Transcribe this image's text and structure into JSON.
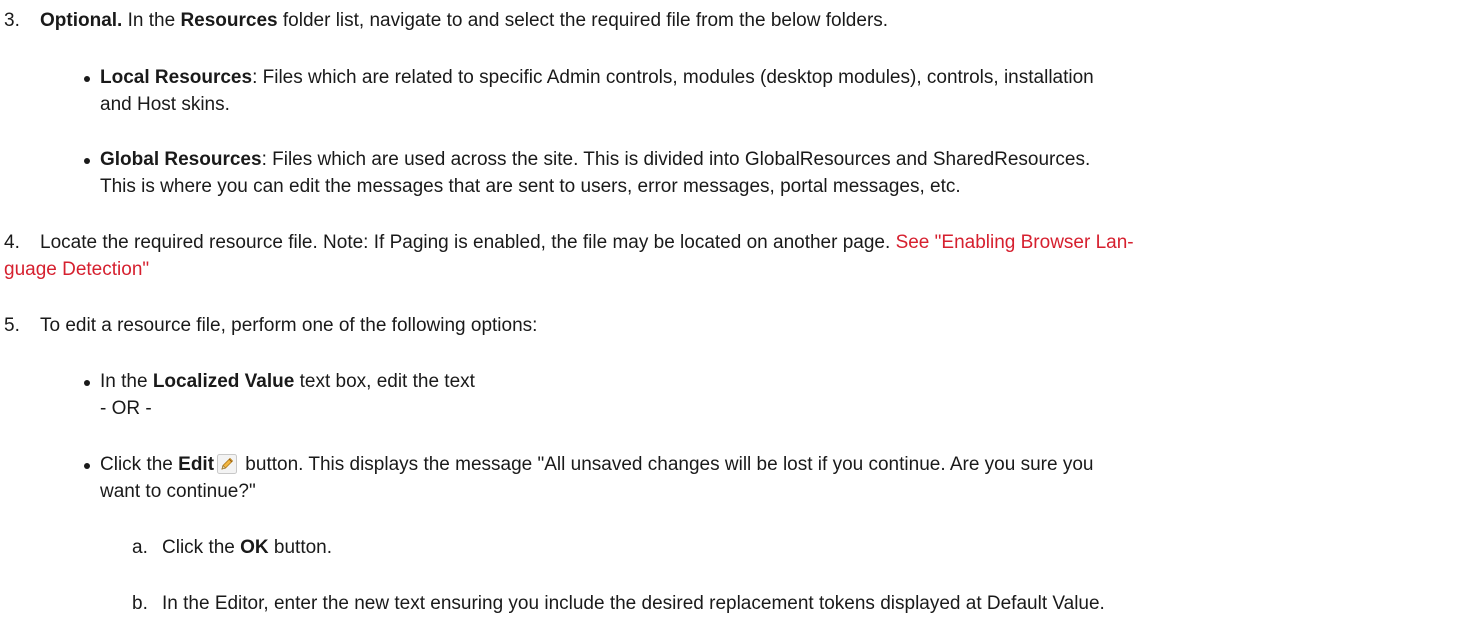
{
  "step3": {
    "number": "3.",
    "lead_bold": "Optional.",
    "text_a": " In the ",
    "resources_bold": "Resources",
    "text_b": " folder list, navigate to and select the required file from the below folders."
  },
  "bullet_local": {
    "title": "Local Resources",
    "text": ": Files which are related to specific Admin controls, modules (desktop modules), controls, installation",
    "text_cont": "and Host skins."
  },
  "bullet_global": {
    "title": "Global Resources",
    "text": ": Files which are used across the site. This is divided into GlobalResources and SharedResources.",
    "text_cont": "This is where you can edit the messages that are sent to users, error messages, portal messages, etc."
  },
  "step4": {
    "number": "4.",
    "text": "Locate the required resource file. Note: If Paging is enabled, the file may be located on another page. ",
    "link_line1": "See \"Enabling Browser Lan-",
    "link_line2": "guage Detection\""
  },
  "step5": {
    "number": "5.",
    "text": "To edit a resource file, perform one of the following options:"
  },
  "bullet_localized": {
    "text_a": "In the ",
    "bold": "Localized Value",
    "text_b": " text box, edit the text",
    "or": "- OR -"
  },
  "bullet_edit": {
    "text_a": "Click the ",
    "bold": "Edit",
    "icon": "pencil-edit-icon",
    "text_b": " button. This displays the message \"All unsaved changes will be lost if you continue. Are you sure you",
    "text_cont": "want to continue?\""
  },
  "sub_a": {
    "number": "a.",
    "text_a": "Click the ",
    "bold": "OK",
    "text_b": " button."
  },
  "sub_b": {
    "number": "b.",
    "text": "In the Editor, enter the new text ensuring you include the desired replacement tokens displayed at Default Value."
  },
  "colors": {
    "text": "#1a1a1a",
    "link": "#d6202f"
  }
}
